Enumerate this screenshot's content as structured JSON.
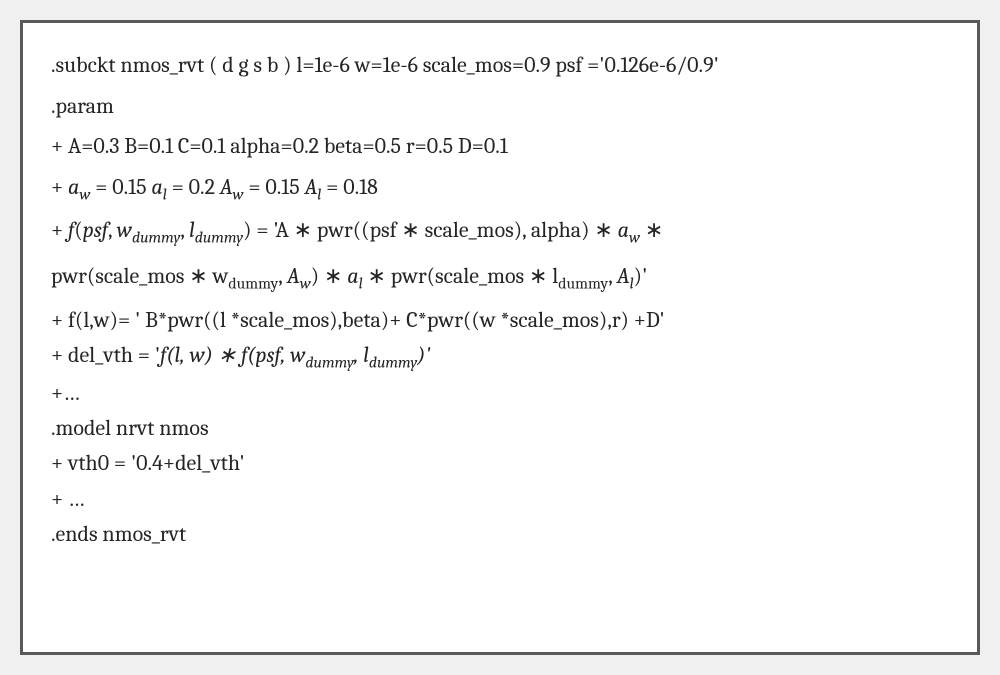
{
  "l1": ".subckt nmos_rvt ( d g s b ) l=1e-6 w=1e-6 scale_mos=0.9 psf ='0.126e-6/0.9'",
  "l2": ".param",
  "l3": "+ A=0.3 B=0.1 C=0.1 alpha=0.2 beta=0.5 r=0.5 D=0.1",
  "l4_prefix": "+  ",
  "l4_aw_val": " = 0.15   ",
  "l4_al_val": " = 0.2  ",
  "l4_Aw_val": " = 0.15  ",
  "l4_Al_val": " = 0.18",
  "l5_prefix": "+ ",
  "l5_f": "f",
  "l5_open": "(",
  "l5_psf": "psf",
  "l5_c1": ", ",
  "l5_w": "w",
  "l5_dummy": "dummy",
  "l5_c2": ", ",
  "l5_l": "l",
  "l5_close_eq": ") = 'A ∗ pwr((psf  ∗ scale_mos), alpha) ∗ ",
  "l5_times": " ∗ ",
  "l6_pre": "pwr(scale_mos ∗ w",
  "l6_c": ", ",
  "l6_mid": ") ∗  ",
  "l6_mid2": " ∗ pwr(scale_mos ∗ l",
  "l6_end": ")'",
  "l7": "+ f(l,w)= ' B*pwr((l *scale_mos),beta)+ C*pwr((w *scale_mos),r) +D'",
  "l8_prefix": "+ del_vth =   '",
  "l8_flw": "f(l, w) ∗ f(psf, w",
  "l8_c": ", ",
  "l8_l": "l",
  "l8_end": ")'",
  "l9": "+…",
  "l10": ".model nrvt nmos",
  "l11": "+ vth0 = '0.4+del_vth'",
  "l12": "+ …",
  "l13": ".ends nmos_rvt",
  "sub_w": "w",
  "sub_l": "l",
  "sym_a": "a",
  "sym_A": "A"
}
